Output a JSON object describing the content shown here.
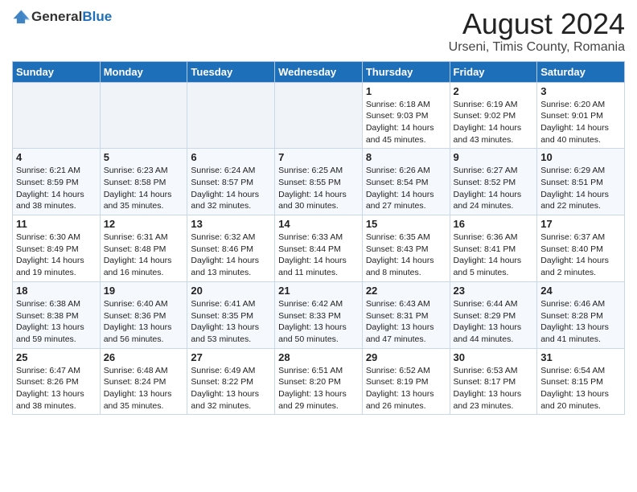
{
  "header": {
    "logo_general": "General",
    "logo_blue": "Blue",
    "month_title": "August 2024",
    "location": "Urseni, Timis County, Romania"
  },
  "weekdays": [
    "Sunday",
    "Monday",
    "Tuesday",
    "Wednesday",
    "Thursday",
    "Friday",
    "Saturday"
  ],
  "weeks": [
    [
      {
        "day": "",
        "info": ""
      },
      {
        "day": "",
        "info": ""
      },
      {
        "day": "",
        "info": ""
      },
      {
        "day": "",
        "info": ""
      },
      {
        "day": "1",
        "info": "Sunrise: 6:18 AM\nSunset: 9:03 PM\nDaylight: 14 hours and 45 minutes."
      },
      {
        "day": "2",
        "info": "Sunrise: 6:19 AM\nSunset: 9:02 PM\nDaylight: 14 hours and 43 minutes."
      },
      {
        "day": "3",
        "info": "Sunrise: 6:20 AM\nSunset: 9:01 PM\nDaylight: 14 hours and 40 minutes."
      }
    ],
    [
      {
        "day": "4",
        "info": "Sunrise: 6:21 AM\nSunset: 8:59 PM\nDaylight: 14 hours and 38 minutes."
      },
      {
        "day": "5",
        "info": "Sunrise: 6:23 AM\nSunset: 8:58 PM\nDaylight: 14 hours and 35 minutes."
      },
      {
        "day": "6",
        "info": "Sunrise: 6:24 AM\nSunset: 8:57 PM\nDaylight: 14 hours and 32 minutes."
      },
      {
        "day": "7",
        "info": "Sunrise: 6:25 AM\nSunset: 8:55 PM\nDaylight: 14 hours and 30 minutes."
      },
      {
        "day": "8",
        "info": "Sunrise: 6:26 AM\nSunset: 8:54 PM\nDaylight: 14 hours and 27 minutes."
      },
      {
        "day": "9",
        "info": "Sunrise: 6:27 AM\nSunset: 8:52 PM\nDaylight: 14 hours and 24 minutes."
      },
      {
        "day": "10",
        "info": "Sunrise: 6:29 AM\nSunset: 8:51 PM\nDaylight: 14 hours and 22 minutes."
      }
    ],
    [
      {
        "day": "11",
        "info": "Sunrise: 6:30 AM\nSunset: 8:49 PM\nDaylight: 14 hours and 19 minutes."
      },
      {
        "day": "12",
        "info": "Sunrise: 6:31 AM\nSunset: 8:48 PM\nDaylight: 14 hours and 16 minutes."
      },
      {
        "day": "13",
        "info": "Sunrise: 6:32 AM\nSunset: 8:46 PM\nDaylight: 14 hours and 13 minutes."
      },
      {
        "day": "14",
        "info": "Sunrise: 6:33 AM\nSunset: 8:44 PM\nDaylight: 14 hours and 11 minutes."
      },
      {
        "day": "15",
        "info": "Sunrise: 6:35 AM\nSunset: 8:43 PM\nDaylight: 14 hours and 8 minutes."
      },
      {
        "day": "16",
        "info": "Sunrise: 6:36 AM\nSunset: 8:41 PM\nDaylight: 14 hours and 5 minutes."
      },
      {
        "day": "17",
        "info": "Sunrise: 6:37 AM\nSunset: 8:40 PM\nDaylight: 14 hours and 2 minutes."
      }
    ],
    [
      {
        "day": "18",
        "info": "Sunrise: 6:38 AM\nSunset: 8:38 PM\nDaylight: 13 hours and 59 minutes."
      },
      {
        "day": "19",
        "info": "Sunrise: 6:40 AM\nSunset: 8:36 PM\nDaylight: 13 hours and 56 minutes."
      },
      {
        "day": "20",
        "info": "Sunrise: 6:41 AM\nSunset: 8:35 PM\nDaylight: 13 hours and 53 minutes."
      },
      {
        "day": "21",
        "info": "Sunrise: 6:42 AM\nSunset: 8:33 PM\nDaylight: 13 hours and 50 minutes."
      },
      {
        "day": "22",
        "info": "Sunrise: 6:43 AM\nSunset: 8:31 PM\nDaylight: 13 hours and 47 minutes."
      },
      {
        "day": "23",
        "info": "Sunrise: 6:44 AM\nSunset: 8:29 PM\nDaylight: 13 hours and 44 minutes."
      },
      {
        "day": "24",
        "info": "Sunrise: 6:46 AM\nSunset: 8:28 PM\nDaylight: 13 hours and 41 minutes."
      }
    ],
    [
      {
        "day": "25",
        "info": "Sunrise: 6:47 AM\nSunset: 8:26 PM\nDaylight: 13 hours and 38 minutes."
      },
      {
        "day": "26",
        "info": "Sunrise: 6:48 AM\nSunset: 8:24 PM\nDaylight: 13 hours and 35 minutes."
      },
      {
        "day": "27",
        "info": "Sunrise: 6:49 AM\nSunset: 8:22 PM\nDaylight: 13 hours and 32 minutes."
      },
      {
        "day": "28",
        "info": "Sunrise: 6:51 AM\nSunset: 8:20 PM\nDaylight: 13 hours and 29 minutes."
      },
      {
        "day": "29",
        "info": "Sunrise: 6:52 AM\nSunset: 8:19 PM\nDaylight: 13 hours and 26 minutes."
      },
      {
        "day": "30",
        "info": "Sunrise: 6:53 AM\nSunset: 8:17 PM\nDaylight: 13 hours and 23 minutes."
      },
      {
        "day": "31",
        "info": "Sunrise: 6:54 AM\nSunset: 8:15 PM\nDaylight: 13 hours and 20 minutes."
      }
    ]
  ]
}
